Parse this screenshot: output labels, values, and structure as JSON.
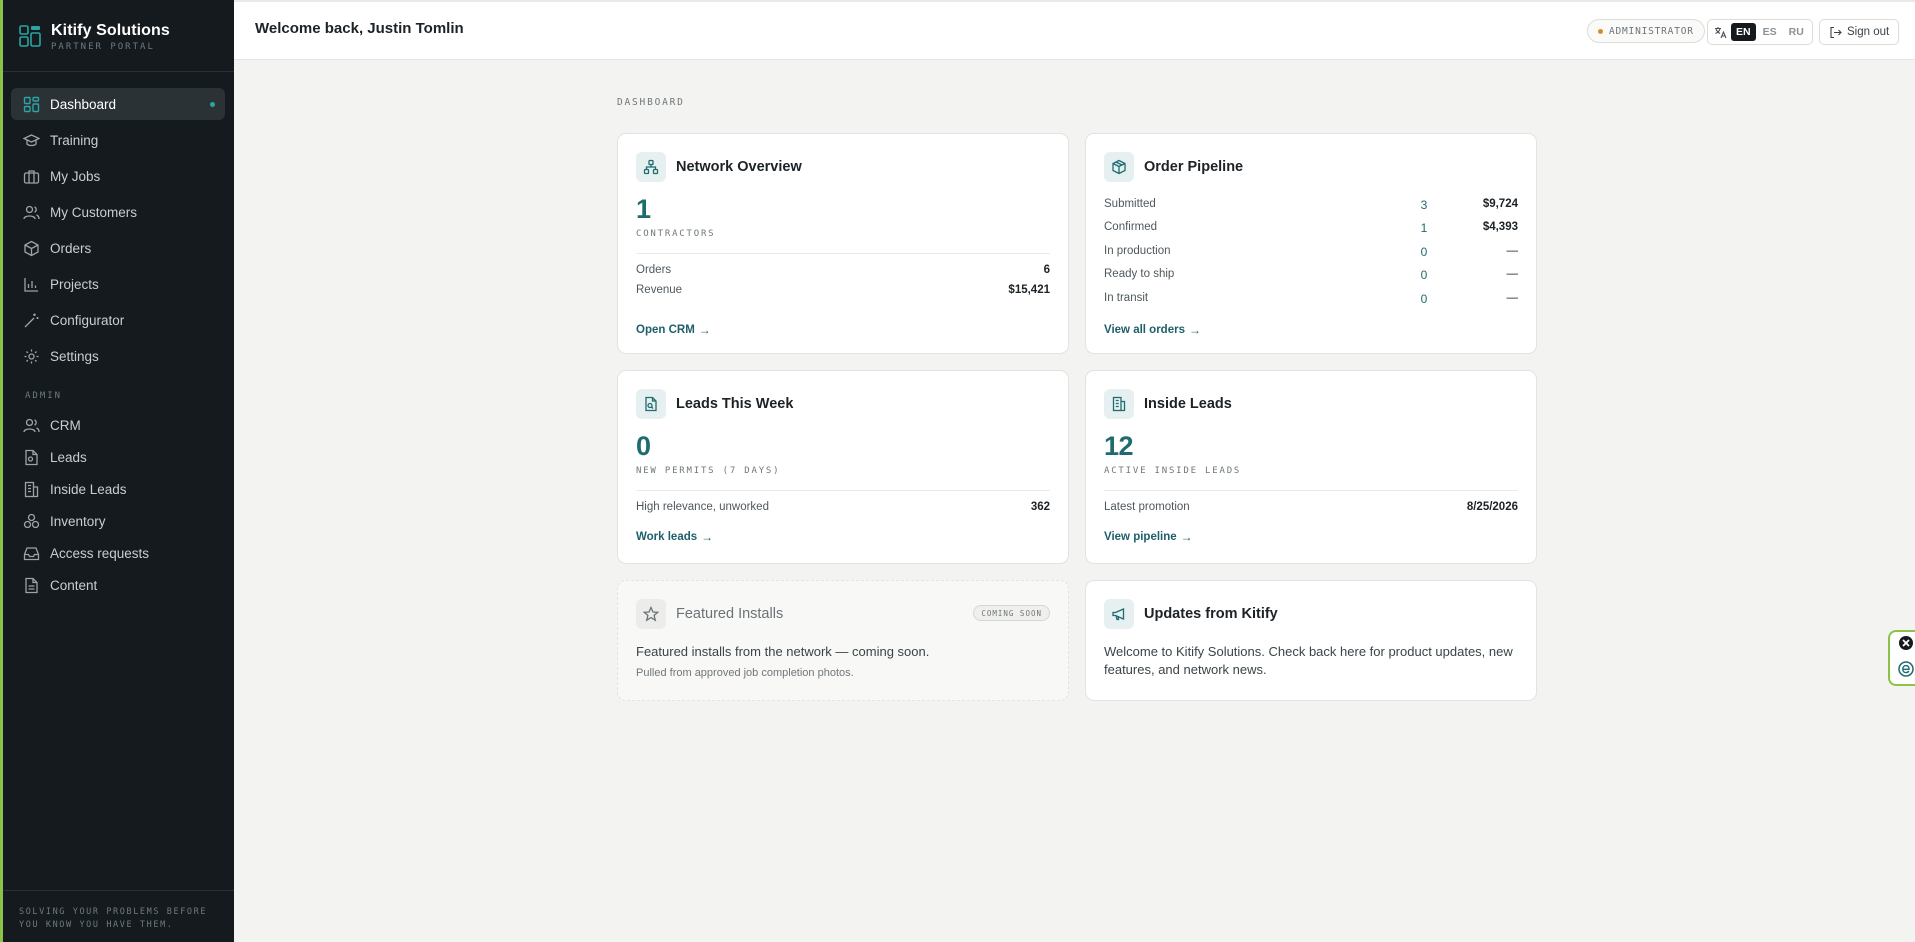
{
  "brand": {
    "name": "Kitify Solutions",
    "subtitle": "PARTNER PORTAL"
  },
  "sidebar": {
    "items": [
      {
        "label": "Dashboard",
        "icon": "dashboard-icon",
        "active": true
      },
      {
        "label": "Training",
        "icon": "graduation-cap-icon"
      },
      {
        "label": "My Jobs",
        "icon": "briefcase-icon"
      },
      {
        "label": "My Customers",
        "icon": "users-icon"
      },
      {
        "label": "Orders",
        "icon": "box-icon"
      },
      {
        "label": "Projects",
        "icon": "chart-icon"
      },
      {
        "label": "Configurator",
        "icon": "wand-icon"
      },
      {
        "label": "Settings",
        "icon": "gear-icon"
      }
    ],
    "admin_label": "ADMIN",
    "admin_items": [
      {
        "label": "CRM",
        "icon": "users-icon"
      },
      {
        "label": "Leads",
        "icon": "document-icon"
      },
      {
        "label": "Inside Leads",
        "icon": "building-icon"
      },
      {
        "label": "Inventory",
        "icon": "boxes-icon"
      },
      {
        "label": "Access requests",
        "icon": "inbox-icon"
      },
      {
        "label": "Content",
        "icon": "file-text-icon"
      }
    ],
    "footer": "SOLVING YOUR PROBLEMS BEFORE YOU KNOW YOU HAVE THEM."
  },
  "topbar": {
    "welcome": "Welcome back, Justin Tomlin",
    "role": "ADMINISTRATOR",
    "languages": [
      "EN",
      "ES",
      "RU"
    ],
    "selected_language": "EN",
    "sign_out": "Sign out"
  },
  "main": {
    "section_label": "DASHBOARD",
    "network": {
      "title": "Network Overview",
      "count": "1",
      "caption": "CONTRACTORS",
      "rows": [
        {
          "label": "Orders",
          "value": "6"
        },
        {
          "label": "Revenue",
          "value": "$15,421"
        }
      ],
      "link": "Open CRM"
    },
    "pipeline": {
      "title": "Order Pipeline",
      "rows": [
        {
          "label": "Submitted",
          "count": "3",
          "value": "$9,724"
        },
        {
          "label": "Confirmed",
          "count": "1",
          "value": "$4,393"
        },
        {
          "label": "In production",
          "count": "0",
          "value": "—"
        },
        {
          "label": "Ready to ship",
          "count": "0",
          "value": "—"
        },
        {
          "label": "In transit",
          "count": "0",
          "value": "—"
        }
      ],
      "link": "View all orders"
    },
    "leads": {
      "title": "Leads This Week",
      "count": "0",
      "caption": "NEW PERMITS (7 DAYS)",
      "row": {
        "label": "High relevance, unworked",
        "value": "362"
      },
      "link": "Work leads"
    },
    "inside": {
      "title": "Inside Leads",
      "count": "12",
      "caption": "ACTIVE INSIDE LEADS",
      "row": {
        "label": "Latest promotion",
        "value": "8/25/2026"
      },
      "link": "View pipeline"
    },
    "featured": {
      "title": "Featured Installs",
      "badge": "COMING SOON",
      "text": "Featured installs from the network — coming soon.",
      "subtext": "Pulled from approved job completion photos."
    },
    "updates": {
      "title": "Updates from Kitify",
      "text": "Welcome to Kitify Solutions. Check back here for product updates, new features, and network news."
    }
  },
  "colors": {
    "accent": "#1e6b70",
    "sidebar_bg": "#141a1e",
    "brand_green": "#8bc34a"
  }
}
